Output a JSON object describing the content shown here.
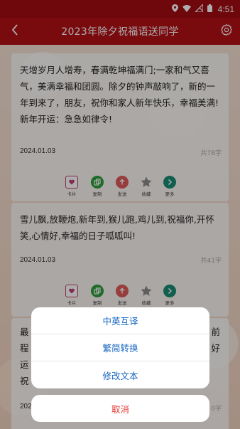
{
  "statusbar": {
    "icons": [
      "location-icon",
      "wifi-icon",
      "signal-off-icon",
      "battery-icon"
    ],
    "time": "4:51"
  },
  "appbar": {
    "title": "2023年除夕祝福语送同学",
    "back_icon": "chevron-left-icon",
    "settings_icon": "gear-icon"
  },
  "cards": [
    {
      "text": "天增岁月人增寿，春满乾坤福满门;一家和气又喜气，美满幸福和团圆。除夕的钟声敲响了，新的一年到来了，朋友，祝你和家人新年快乐，幸福美满!新年开运：急急如律令!",
      "date": "2024.01.03",
      "count": "共78字"
    },
    {
      "text": "雪儿飘,放鞭炮,新年到,猴儿跑,鸡儿到,祝福你,开怀笑,心情好,幸福的日子呱呱叫!",
      "date": "2024.01.03",
      "count": "共41字"
    },
    {
      "text_fragments": [
        "最",
        "前",
        "程",
        "好",
        "运",
        "祝"
      ],
      "date": "202",
      "count": "0字"
    }
  ],
  "actions": [
    {
      "label": "卡片",
      "icon": "card-icon",
      "color": "#c0406e"
    },
    {
      "label": "复制",
      "icon": "copy-icon",
      "color": "#2e9e3a"
    },
    {
      "label": "发送",
      "icon": "send-icon",
      "color": "#e05a5a"
    },
    {
      "label": "收藏",
      "icon": "star-icon",
      "color": "#8c8c8c"
    },
    {
      "label": "更多",
      "icon": "more-icon",
      "color": "#1a8c74"
    }
  ],
  "sheet": {
    "options": [
      "中英互译",
      "繁简转换",
      "修改文本"
    ],
    "cancel": "取消"
  },
  "colors": {
    "appbar": "#b30f16",
    "statusbar": "#a30d12",
    "option_text": "#1565c0",
    "cancel_text": "#e53935"
  }
}
